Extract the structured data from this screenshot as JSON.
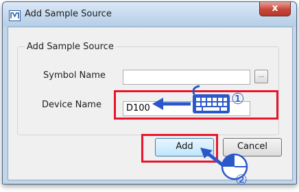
{
  "window": {
    "title": "Add Sample Source",
    "close_glyph": "x"
  },
  "group": {
    "title": "Add Sample Source"
  },
  "fields": {
    "symbol_name_label": "Symbol Name",
    "symbol_name_value": "",
    "browse_label": "...",
    "device_name_label": "Device Name",
    "device_name_value": "D100"
  },
  "buttons": {
    "add": "Add",
    "cancel": "Cancel"
  },
  "annotations": {
    "step1": "①",
    "step2": "②",
    "highlight_color": "#e8142a",
    "accent_color": "#2b58c9",
    "step1_icon": "keyboard-icon",
    "step2_icon": "mouse-click-icon"
  }
}
